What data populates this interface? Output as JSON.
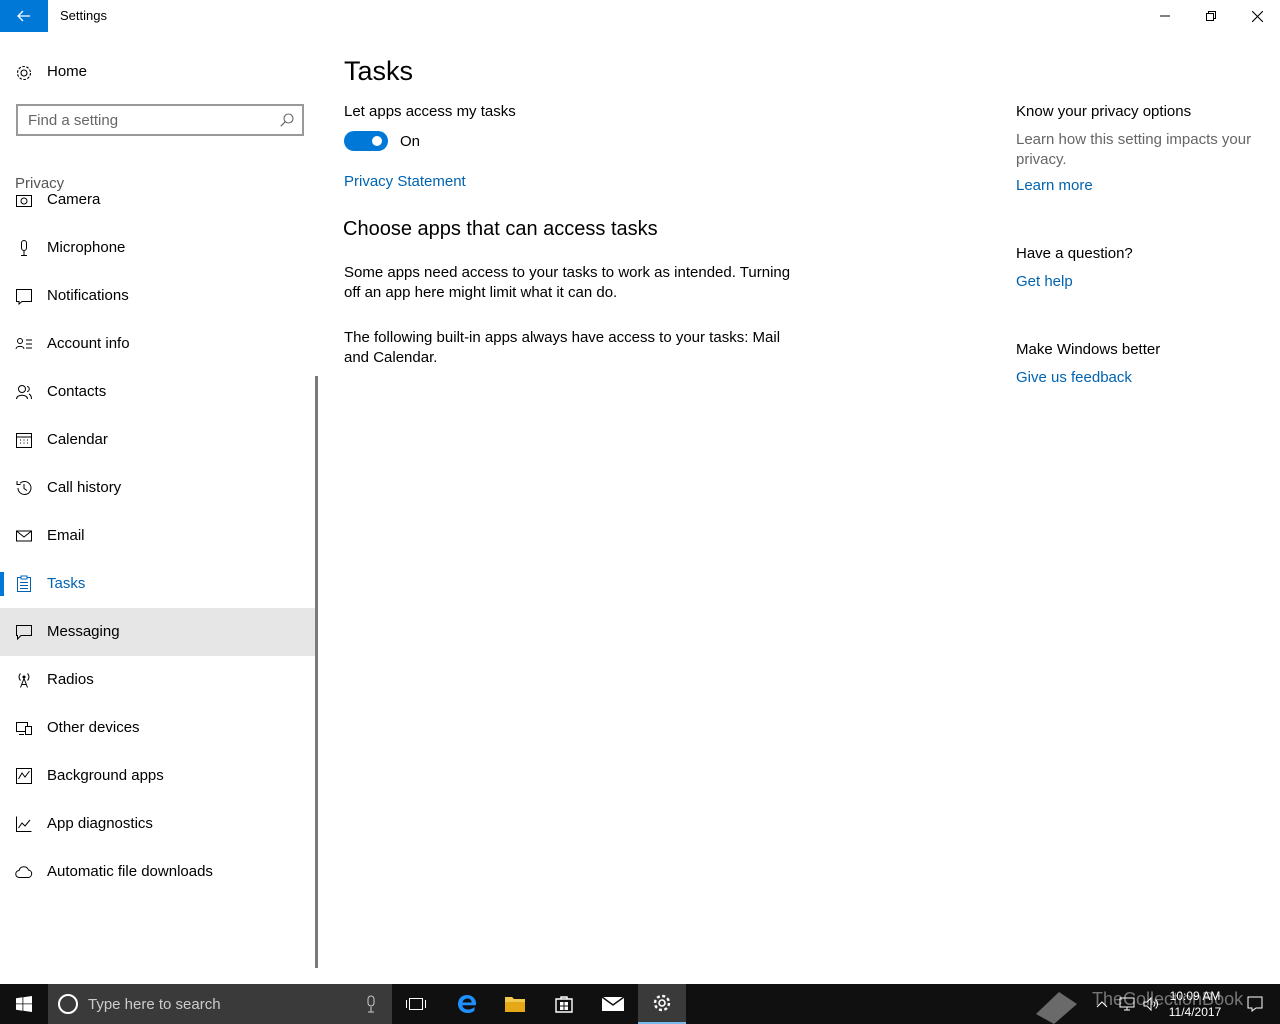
{
  "window": {
    "title": "Settings"
  },
  "sidebar": {
    "home_label": "Home",
    "search_placeholder": "Find a setting",
    "section_label": "Privacy",
    "items": [
      {
        "label": "Camera",
        "icon": "camera-icon"
      },
      {
        "label": "Microphone",
        "icon": "microphone-icon"
      },
      {
        "label": "Notifications",
        "icon": "notifications-icon"
      },
      {
        "label": "Account info",
        "icon": "account-info-icon"
      },
      {
        "label": "Contacts",
        "icon": "contacts-icon"
      },
      {
        "label": "Calendar",
        "icon": "calendar-icon"
      },
      {
        "label": "Call history",
        "icon": "history-icon"
      },
      {
        "label": "Email",
        "icon": "email-icon"
      },
      {
        "label": "Tasks",
        "icon": "tasks-icon",
        "selected": true
      },
      {
        "label": "Messaging",
        "icon": "messaging-icon",
        "hovered": true
      },
      {
        "label": "Radios",
        "icon": "radios-icon"
      },
      {
        "label": "Other devices",
        "icon": "other-devices-icon"
      },
      {
        "label": "Background apps",
        "icon": "background-apps-icon"
      },
      {
        "label": "App diagnostics",
        "icon": "app-diagnostics-icon"
      },
      {
        "label": "Automatic file downloads",
        "icon": "cloud-icon"
      }
    ]
  },
  "main": {
    "title": "Tasks",
    "toggle_label": "Let apps access my tasks",
    "toggle_state": "On",
    "privacy_link": "Privacy Statement",
    "section_title": "Choose apps that can access tasks",
    "paragraph1": "Some apps need access to your tasks to work as intended. Turning off an app here might limit what it can do.",
    "paragraph2": "The following built-in apps always have access to your tasks: Mail and Calendar."
  },
  "aside": {
    "privacy_heading": "Know your privacy options",
    "privacy_text": "Learn how this setting impacts your privacy.",
    "learn_more": "Learn more",
    "question_heading": "Have a question?",
    "get_help": "Get help",
    "feedback_heading": "Make Windows better",
    "feedback_link": "Give us feedback"
  },
  "taskbar": {
    "search_placeholder": "Type here to search",
    "time": "10:09 AM",
    "date": "11/4/2017",
    "watermark": "TheCollectionBook"
  },
  "colors": {
    "accent": "#0078d7",
    "link": "#0063b1",
    "taskbar": "#101010"
  }
}
